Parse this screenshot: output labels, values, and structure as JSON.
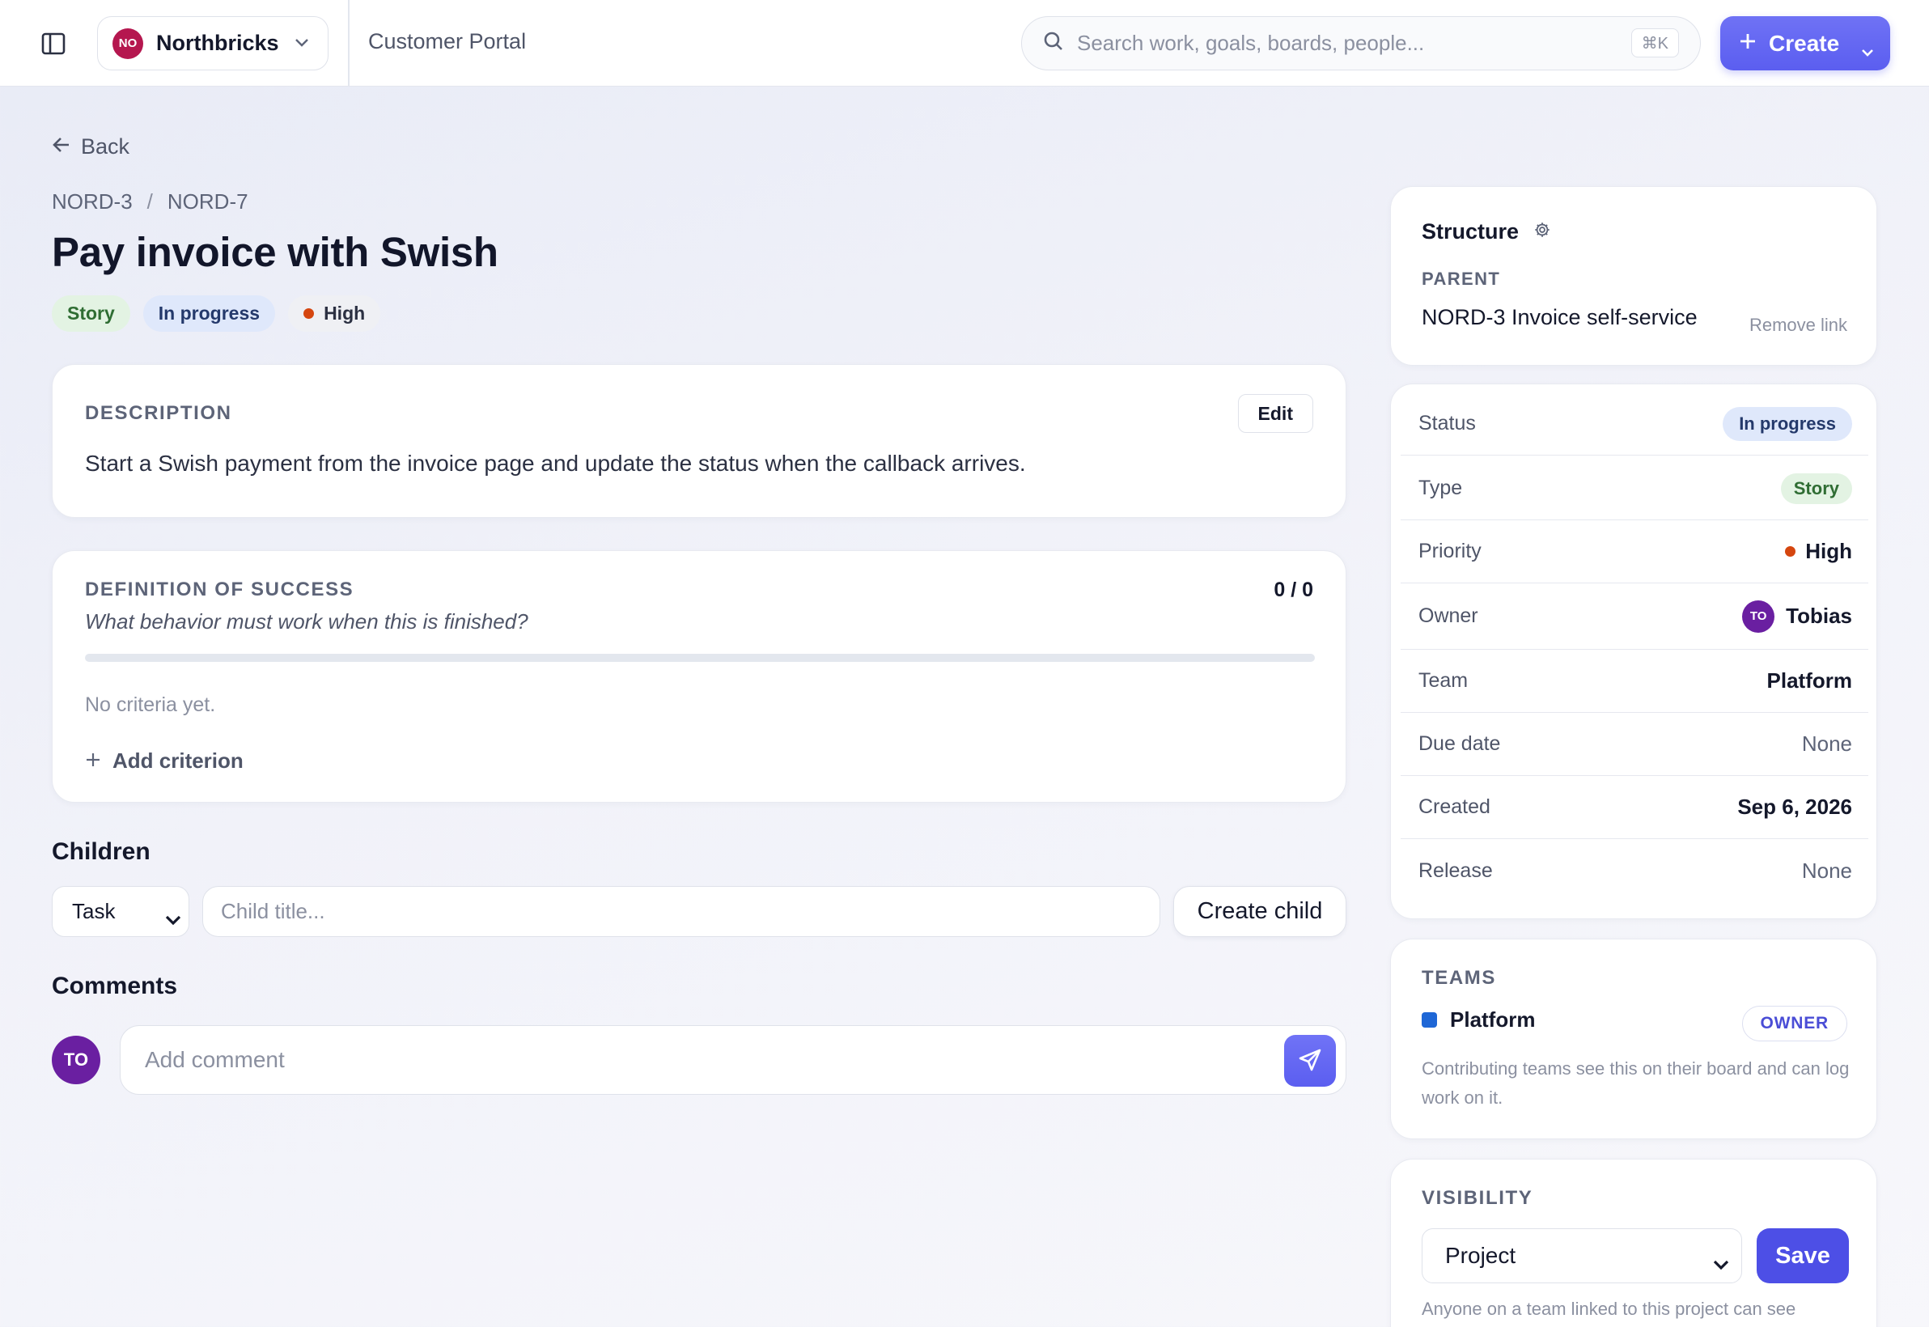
{
  "topbar": {
    "workspace_initials": "NO",
    "workspace_name": "Northbricks",
    "project_name": "Customer Portal",
    "search_placeholder": "Search work, goals, boards, people...",
    "search_shortcut": "⌘K",
    "create_label": "Create"
  },
  "nav": {
    "back_label": "Back",
    "breadcrumb": [
      "NORD-3",
      "NORD-7"
    ],
    "breadcrumb_sep": "/"
  },
  "issue": {
    "title": "Pay invoice with Swish",
    "badges": {
      "type": "Story",
      "status": "In progress",
      "priority": "High"
    }
  },
  "description": {
    "label": "DESCRIPTION",
    "edit_label": "Edit",
    "text": "Start a Swish payment from the invoice page and update the status when the callback arrives."
  },
  "definition_of_success": {
    "label": "DEFINITION OF SUCCESS",
    "count": "0 / 0",
    "question": "What behavior must work when this is finished?",
    "progress_fraction": 0,
    "empty_text": "No criteria yet.",
    "add_label": "Add criterion"
  },
  "children": {
    "heading": "Children",
    "type_value": "Task",
    "title_placeholder": "Child title...",
    "create_label": "Create child"
  },
  "comments": {
    "heading": "Comments",
    "avatar_initials": "TO",
    "placeholder": "Add comment"
  },
  "structure": {
    "title": "Structure",
    "parent_label": "PARENT",
    "parent_value": "NORD-3 Invoice self-service",
    "remove_label": "Remove link"
  },
  "properties": {
    "status": {
      "key": "Status",
      "value": "In progress"
    },
    "type": {
      "key": "Type",
      "value": "Story"
    },
    "priority": {
      "key": "Priority",
      "value": "High"
    },
    "owner": {
      "key": "Owner",
      "initials": "TO",
      "value": "Tobias"
    },
    "team": {
      "key": "Team",
      "value": "Platform"
    },
    "due_date": {
      "key": "Due date",
      "value": "None"
    },
    "created": {
      "key": "Created",
      "value": "Sep 6, 2026"
    },
    "release": {
      "key": "Release",
      "value": "None"
    }
  },
  "teams": {
    "label": "TEAMS",
    "team_name": "Platform",
    "role": "OWNER",
    "help": "Contributing teams see this on their board and can log work on it."
  },
  "visibility": {
    "label": "VISIBILITY",
    "value": "Project",
    "save_label": "Save",
    "help": "Anyone on a team linked to this project can see"
  },
  "colors": {
    "accent": "#5b5ef0",
    "workspace_avatar": "#b5174f",
    "user_avatar": "#6a1fa1",
    "priority_high": "#d5460f",
    "team_platform": "#1f67d6"
  }
}
